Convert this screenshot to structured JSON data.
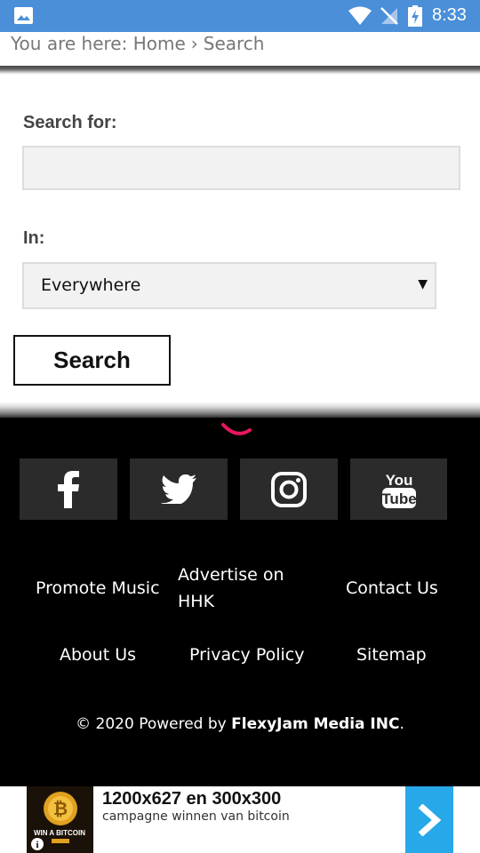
{
  "status_bar": {
    "time": "8:33"
  },
  "breadcrumb": {
    "prefix": "You are here:",
    "home": "Home",
    "separator": "›",
    "current": "Search"
  },
  "form": {
    "search_label": "Search for:",
    "search_value": "",
    "in_label": "In:",
    "in_selected": "Everywhere",
    "submit_label": "Search"
  },
  "footer": {
    "social": [
      {
        "name": "facebook",
        "icon": "facebook-icon"
      },
      {
        "name": "twitter",
        "icon": "twitter-icon"
      },
      {
        "name": "instagram",
        "icon": "instagram-icon"
      },
      {
        "name": "youtube",
        "icon": "youtube-icon"
      }
    ],
    "links": {
      "promote": "Promote Music",
      "advertise_line1": "Advertise on",
      "advertise_line2": "HHK",
      "contact": "Contact Us",
      "about": "About Us",
      "privacy": "Privacy Policy",
      "sitemap": "Sitemap"
    },
    "copyright_prefix": "© 2020 Powered by ",
    "copyright_company": "FlexyJam Media INC",
    "copyright_suffix": "."
  },
  "ad": {
    "headline": "1200x627 en 300x300",
    "subtext": "campagne winnen van bitcoin",
    "thumb_text": "WIN A BITCOIN",
    "accent": "#27a8e8"
  },
  "colors": {
    "status_bar": "#4a8fd8",
    "spinner": "#e8175d",
    "footer_bg": "#000000"
  }
}
